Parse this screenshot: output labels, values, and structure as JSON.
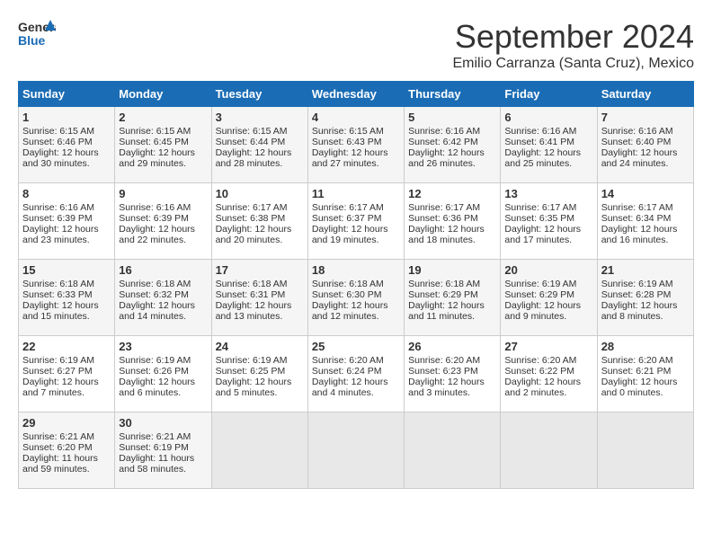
{
  "logo": {
    "line1": "General",
    "line2": "Blue"
  },
  "title": "September 2024",
  "subtitle": "Emilio Carranza (Santa Cruz), Mexico",
  "days_of_week": [
    "Sunday",
    "Monday",
    "Tuesday",
    "Wednesday",
    "Thursday",
    "Friday",
    "Saturday"
  ],
  "weeks": [
    [
      {
        "day": "1",
        "sunrise": "6:15 AM",
        "sunset": "6:46 PM",
        "daylight": "12 hours and 30 minutes."
      },
      {
        "day": "2",
        "sunrise": "6:15 AM",
        "sunset": "6:45 PM",
        "daylight": "12 hours and 29 minutes."
      },
      {
        "day": "3",
        "sunrise": "6:15 AM",
        "sunset": "6:44 PM",
        "daylight": "12 hours and 28 minutes."
      },
      {
        "day": "4",
        "sunrise": "6:15 AM",
        "sunset": "6:43 PM",
        "daylight": "12 hours and 27 minutes."
      },
      {
        "day": "5",
        "sunrise": "6:16 AM",
        "sunset": "6:42 PM",
        "daylight": "12 hours and 26 minutes."
      },
      {
        "day": "6",
        "sunrise": "6:16 AM",
        "sunset": "6:41 PM",
        "daylight": "12 hours and 25 minutes."
      },
      {
        "day": "7",
        "sunrise": "6:16 AM",
        "sunset": "6:40 PM",
        "daylight": "12 hours and 24 minutes."
      }
    ],
    [
      {
        "day": "8",
        "sunrise": "6:16 AM",
        "sunset": "6:39 PM",
        "daylight": "12 hours and 23 minutes."
      },
      {
        "day": "9",
        "sunrise": "6:16 AM",
        "sunset": "6:39 PM",
        "daylight": "12 hours and 22 minutes."
      },
      {
        "day": "10",
        "sunrise": "6:17 AM",
        "sunset": "6:38 PM",
        "daylight": "12 hours and 20 minutes."
      },
      {
        "day": "11",
        "sunrise": "6:17 AM",
        "sunset": "6:37 PM",
        "daylight": "12 hours and 19 minutes."
      },
      {
        "day": "12",
        "sunrise": "6:17 AM",
        "sunset": "6:36 PM",
        "daylight": "12 hours and 18 minutes."
      },
      {
        "day": "13",
        "sunrise": "6:17 AM",
        "sunset": "6:35 PM",
        "daylight": "12 hours and 17 minutes."
      },
      {
        "day": "14",
        "sunrise": "6:17 AM",
        "sunset": "6:34 PM",
        "daylight": "12 hours and 16 minutes."
      }
    ],
    [
      {
        "day": "15",
        "sunrise": "6:18 AM",
        "sunset": "6:33 PM",
        "daylight": "12 hours and 15 minutes."
      },
      {
        "day": "16",
        "sunrise": "6:18 AM",
        "sunset": "6:32 PM",
        "daylight": "12 hours and 14 minutes."
      },
      {
        "day": "17",
        "sunrise": "6:18 AM",
        "sunset": "6:31 PM",
        "daylight": "12 hours and 13 minutes."
      },
      {
        "day": "18",
        "sunrise": "6:18 AM",
        "sunset": "6:30 PM",
        "daylight": "12 hours and 12 minutes."
      },
      {
        "day": "19",
        "sunrise": "6:18 AM",
        "sunset": "6:29 PM",
        "daylight": "12 hours and 11 minutes."
      },
      {
        "day": "20",
        "sunrise": "6:19 AM",
        "sunset": "6:29 PM",
        "daylight": "12 hours and 9 minutes."
      },
      {
        "day": "21",
        "sunrise": "6:19 AM",
        "sunset": "6:28 PM",
        "daylight": "12 hours and 8 minutes."
      }
    ],
    [
      {
        "day": "22",
        "sunrise": "6:19 AM",
        "sunset": "6:27 PM",
        "daylight": "12 hours and 7 minutes."
      },
      {
        "day": "23",
        "sunrise": "6:19 AM",
        "sunset": "6:26 PM",
        "daylight": "12 hours and 6 minutes."
      },
      {
        "day": "24",
        "sunrise": "6:19 AM",
        "sunset": "6:25 PM",
        "daylight": "12 hours and 5 minutes."
      },
      {
        "day": "25",
        "sunrise": "6:20 AM",
        "sunset": "6:24 PM",
        "daylight": "12 hours and 4 minutes."
      },
      {
        "day": "26",
        "sunrise": "6:20 AM",
        "sunset": "6:23 PM",
        "daylight": "12 hours and 3 minutes."
      },
      {
        "day": "27",
        "sunrise": "6:20 AM",
        "sunset": "6:22 PM",
        "daylight": "12 hours and 2 minutes."
      },
      {
        "day": "28",
        "sunrise": "6:20 AM",
        "sunset": "6:21 PM",
        "daylight": "12 hours and 0 minutes."
      }
    ],
    [
      {
        "day": "29",
        "sunrise": "6:21 AM",
        "sunset": "6:20 PM",
        "daylight": "11 hours and 59 minutes."
      },
      {
        "day": "30",
        "sunrise": "6:21 AM",
        "sunset": "6:19 PM",
        "daylight": "11 hours and 58 minutes."
      },
      null,
      null,
      null,
      null,
      null
    ]
  ],
  "labels": {
    "sunrise": "Sunrise: ",
    "sunset": "Sunset: ",
    "daylight": "Daylight: "
  }
}
